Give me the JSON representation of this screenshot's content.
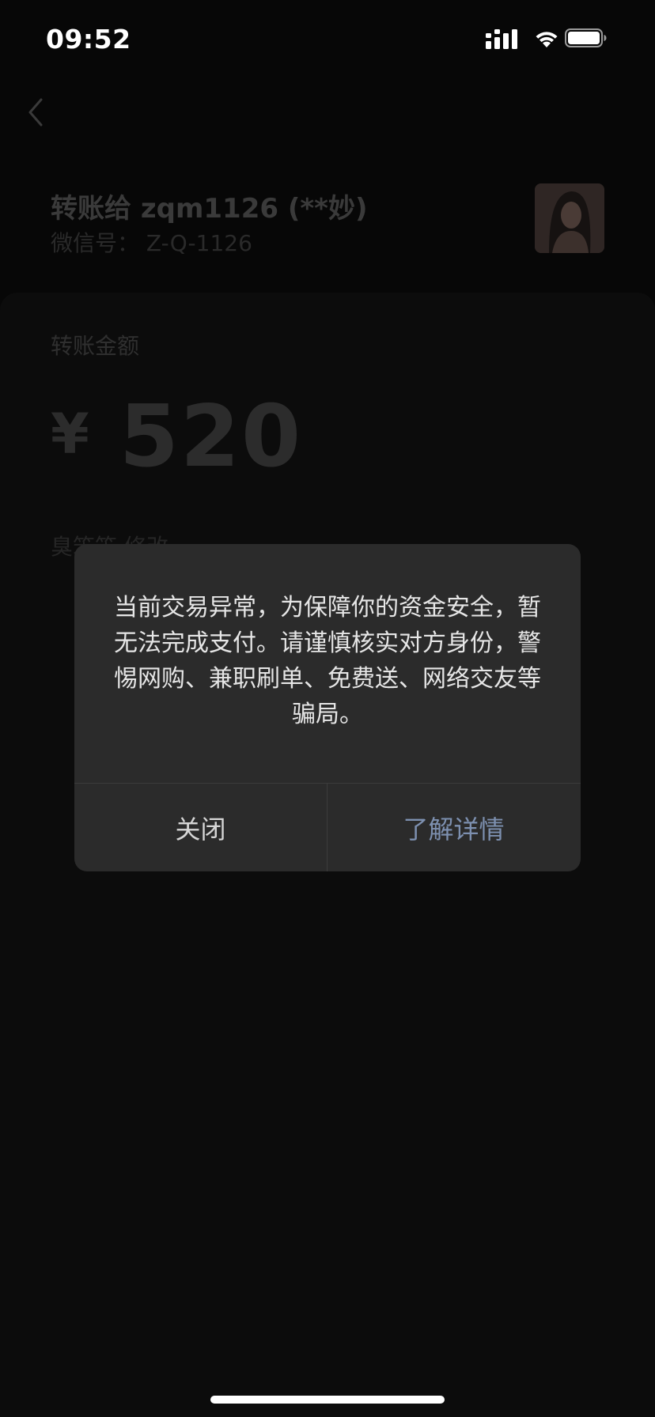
{
  "status_bar": {
    "time": "09:52"
  },
  "payee": {
    "title": "转账给 zqm1126 (**妙)",
    "wechat_id": "微信号： Z-Q-1126"
  },
  "transfer": {
    "amount_label": "转账金额",
    "currency_symbol": "¥",
    "amount": "520",
    "remark": "臭笨笨 修改"
  },
  "dialog": {
    "message": "当前交易异常，为保障你的资金安全，暂无法完成支付。请谨慎核实对方身份，警惕网购、兼职刷单、免费送、网络交友等骗局。",
    "close_label": "关闭",
    "detail_label": "了解详情"
  },
  "colors": {
    "accent_link": "#7d90b0",
    "background": "#070707",
    "dialog_bg": "#2b2b2b"
  }
}
